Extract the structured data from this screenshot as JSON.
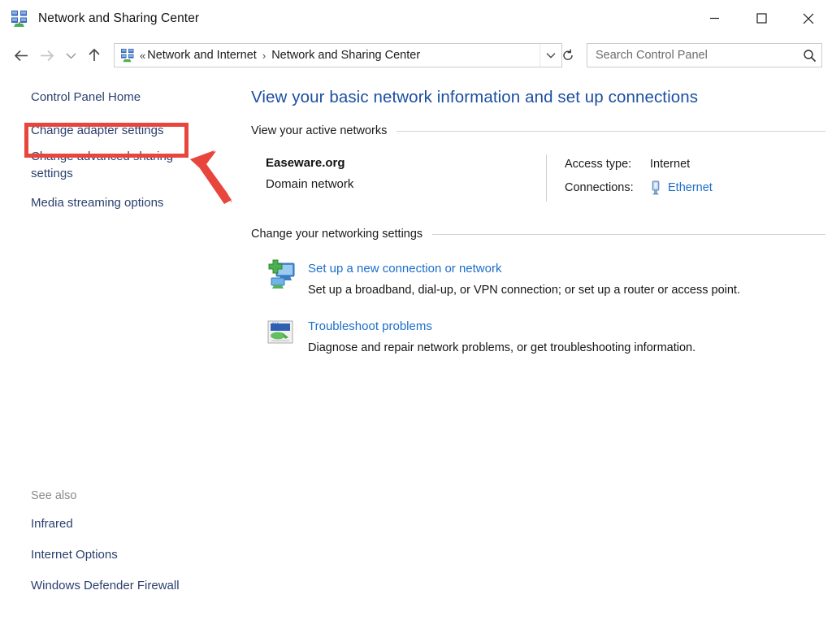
{
  "window": {
    "title": "Network and Sharing Center",
    "icon": "network-icon",
    "controls": {
      "minimize": "minimize-button",
      "maximize": "maximize-button",
      "close": "close-button"
    }
  },
  "navbar": {
    "back": "back-button",
    "forward": "forward-button",
    "recent_dropdown": "recent-locations-button",
    "up": "up-one-level-button",
    "breadcrumb": {
      "separator_double": "«",
      "separator": "›",
      "items": [
        {
          "label": "Network and Internet"
        },
        {
          "label": "Network and Sharing Center"
        }
      ]
    },
    "address_dropdown": "address-dropdown-button",
    "refresh": "refresh-button",
    "search": {
      "placeholder": "Search Control Panel",
      "value": ""
    }
  },
  "sidebar": {
    "items": [
      {
        "label": "Control Panel Home"
      },
      {
        "label": "Change adapter settings"
      },
      {
        "label": "Change advanced sharing settings"
      },
      {
        "label": "Media streaming options"
      }
    ],
    "see_also": {
      "title": "See also",
      "items": [
        {
          "label": "Infrared"
        },
        {
          "label": "Internet Options"
        },
        {
          "label": "Windows Defender Firewall"
        }
      ]
    }
  },
  "main": {
    "heading": "View your basic network information and set up connections",
    "active_networks": {
      "section_title": "View your active networks",
      "network": {
        "name": "Easeware.org",
        "type": "Domain network",
        "access_type_label": "Access type:",
        "access_type_value": "Internet",
        "connections_label": "Connections:",
        "connection_name": "Ethernet",
        "connection_icon": "ethernet-icon"
      }
    },
    "networking_settings": {
      "section_title": "Change your networking settings",
      "tasks": [
        {
          "title": "Set up a new connection or network",
          "description": "Set up a broadband, dial-up, or VPN connection; or set up a router or access point.",
          "icon": "new-connection-icon"
        },
        {
          "title": "Troubleshoot problems",
          "description": "Diagnose and repair network problems, or get troubleshooting information.",
          "icon": "troubleshoot-icon"
        }
      ]
    }
  },
  "annotations": {
    "highlight_color": "#e8453c",
    "highlight_target": "Change adapter settings",
    "arrow": "pointer-arrow"
  },
  "colors": {
    "heading_blue": "#1c4fa1",
    "link_blue": "#1d6ec9",
    "sidebar_link": "#2a3f6e",
    "annotation_red": "#e8453c"
  }
}
